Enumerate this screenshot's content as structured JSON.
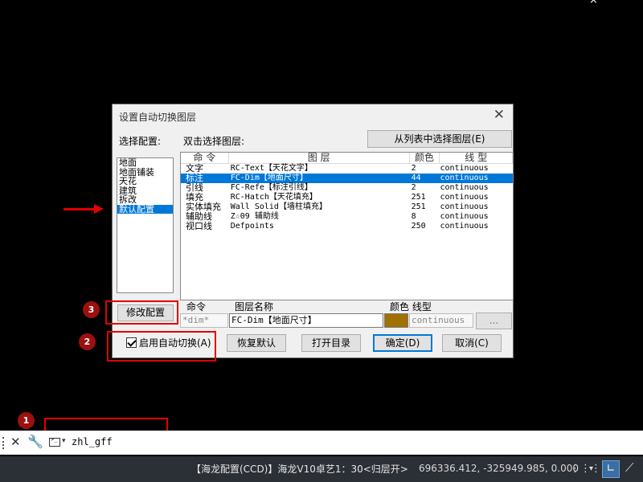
{
  "viewport_close": "×",
  "dialog": {
    "title": "设置自动切换图层",
    "close": "✕",
    "select_config_label": "选择配置:",
    "dbl_click_label": "双击选择图层:",
    "pick_from_list_button": "从列表中选择图层(E)",
    "configs": [
      "地面",
      "地面铺装",
      "天花",
      "建筑",
      "拆改",
      "默认配置"
    ],
    "selected_config_index": 5,
    "columns": [
      "命 令",
      "图 层",
      "颜色",
      "线 型"
    ],
    "rows": [
      {
        "cmd": "文字",
        "layer": "RC-Text【天花文字】",
        "color": "2",
        "linetype": "continuous",
        "selected": false
      },
      {
        "cmd": "标注",
        "layer": "FC-Dim【地面尺寸】",
        "color": "44",
        "linetype": "continuous",
        "selected": true
      },
      {
        "cmd": "引线",
        "layer": "FC-Refe【标注引线】",
        "color": "2",
        "linetype": "continuous",
        "selected": false
      },
      {
        "cmd": "填充",
        "layer": "RC-Hatch【天花填充】",
        "color": "251",
        "linetype": "continuous",
        "selected": false
      },
      {
        "cmd": "实体填充",
        "layer": "Wall Solid【墙柱填充】",
        "color": "251",
        "linetype": "continuous",
        "selected": false
      },
      {
        "cmd": "辅助线",
        "layer": "Z☆09 辅助线",
        "color": "8",
        "linetype": "continuous",
        "selected": false
      },
      {
        "cmd": "视口线",
        "layer": "Defpoints",
        "color": "250",
        "linetype": "continuous",
        "selected": false
      }
    ],
    "edit_labels": {
      "cmd": "命令",
      "layer": "图层名称",
      "color_type": "颜色 线型"
    },
    "edit_cmd_value": "*dim*",
    "edit_layer_value": "FC-Dim【地面尺寸】",
    "edit_color_swatch": "#a07000",
    "edit_linetype_value": "continuous",
    "browse_button": "...",
    "modify_config_button": "修改配置",
    "enable_auto_switch_label": "启用自动切换(A)",
    "enable_auto_switch_checked": true,
    "restore_default_button": "恢复默认",
    "open_dir_button": "打开目录",
    "ok_button": "确定(D)",
    "cancel_button": "取消(C)"
  },
  "annotations": {
    "badge1": "1",
    "badge2": "2",
    "badge3": "3",
    "color": "#e00000"
  },
  "command_line": {
    "close": "✕",
    "wrench": "🔧",
    "dropdown": "▾",
    "text": "zhl_gff"
  },
  "status_bar": {
    "info": "【海龙配置(CCD)】海龙V10卓艺1：30<归层开>",
    "coords": "696336.412, -325949.985, 0.000",
    "grid_icon": "⋮⋮⋮",
    "dropdown": "▾",
    "ortho_icon": "∟",
    "polar_icon": "⟋"
  }
}
